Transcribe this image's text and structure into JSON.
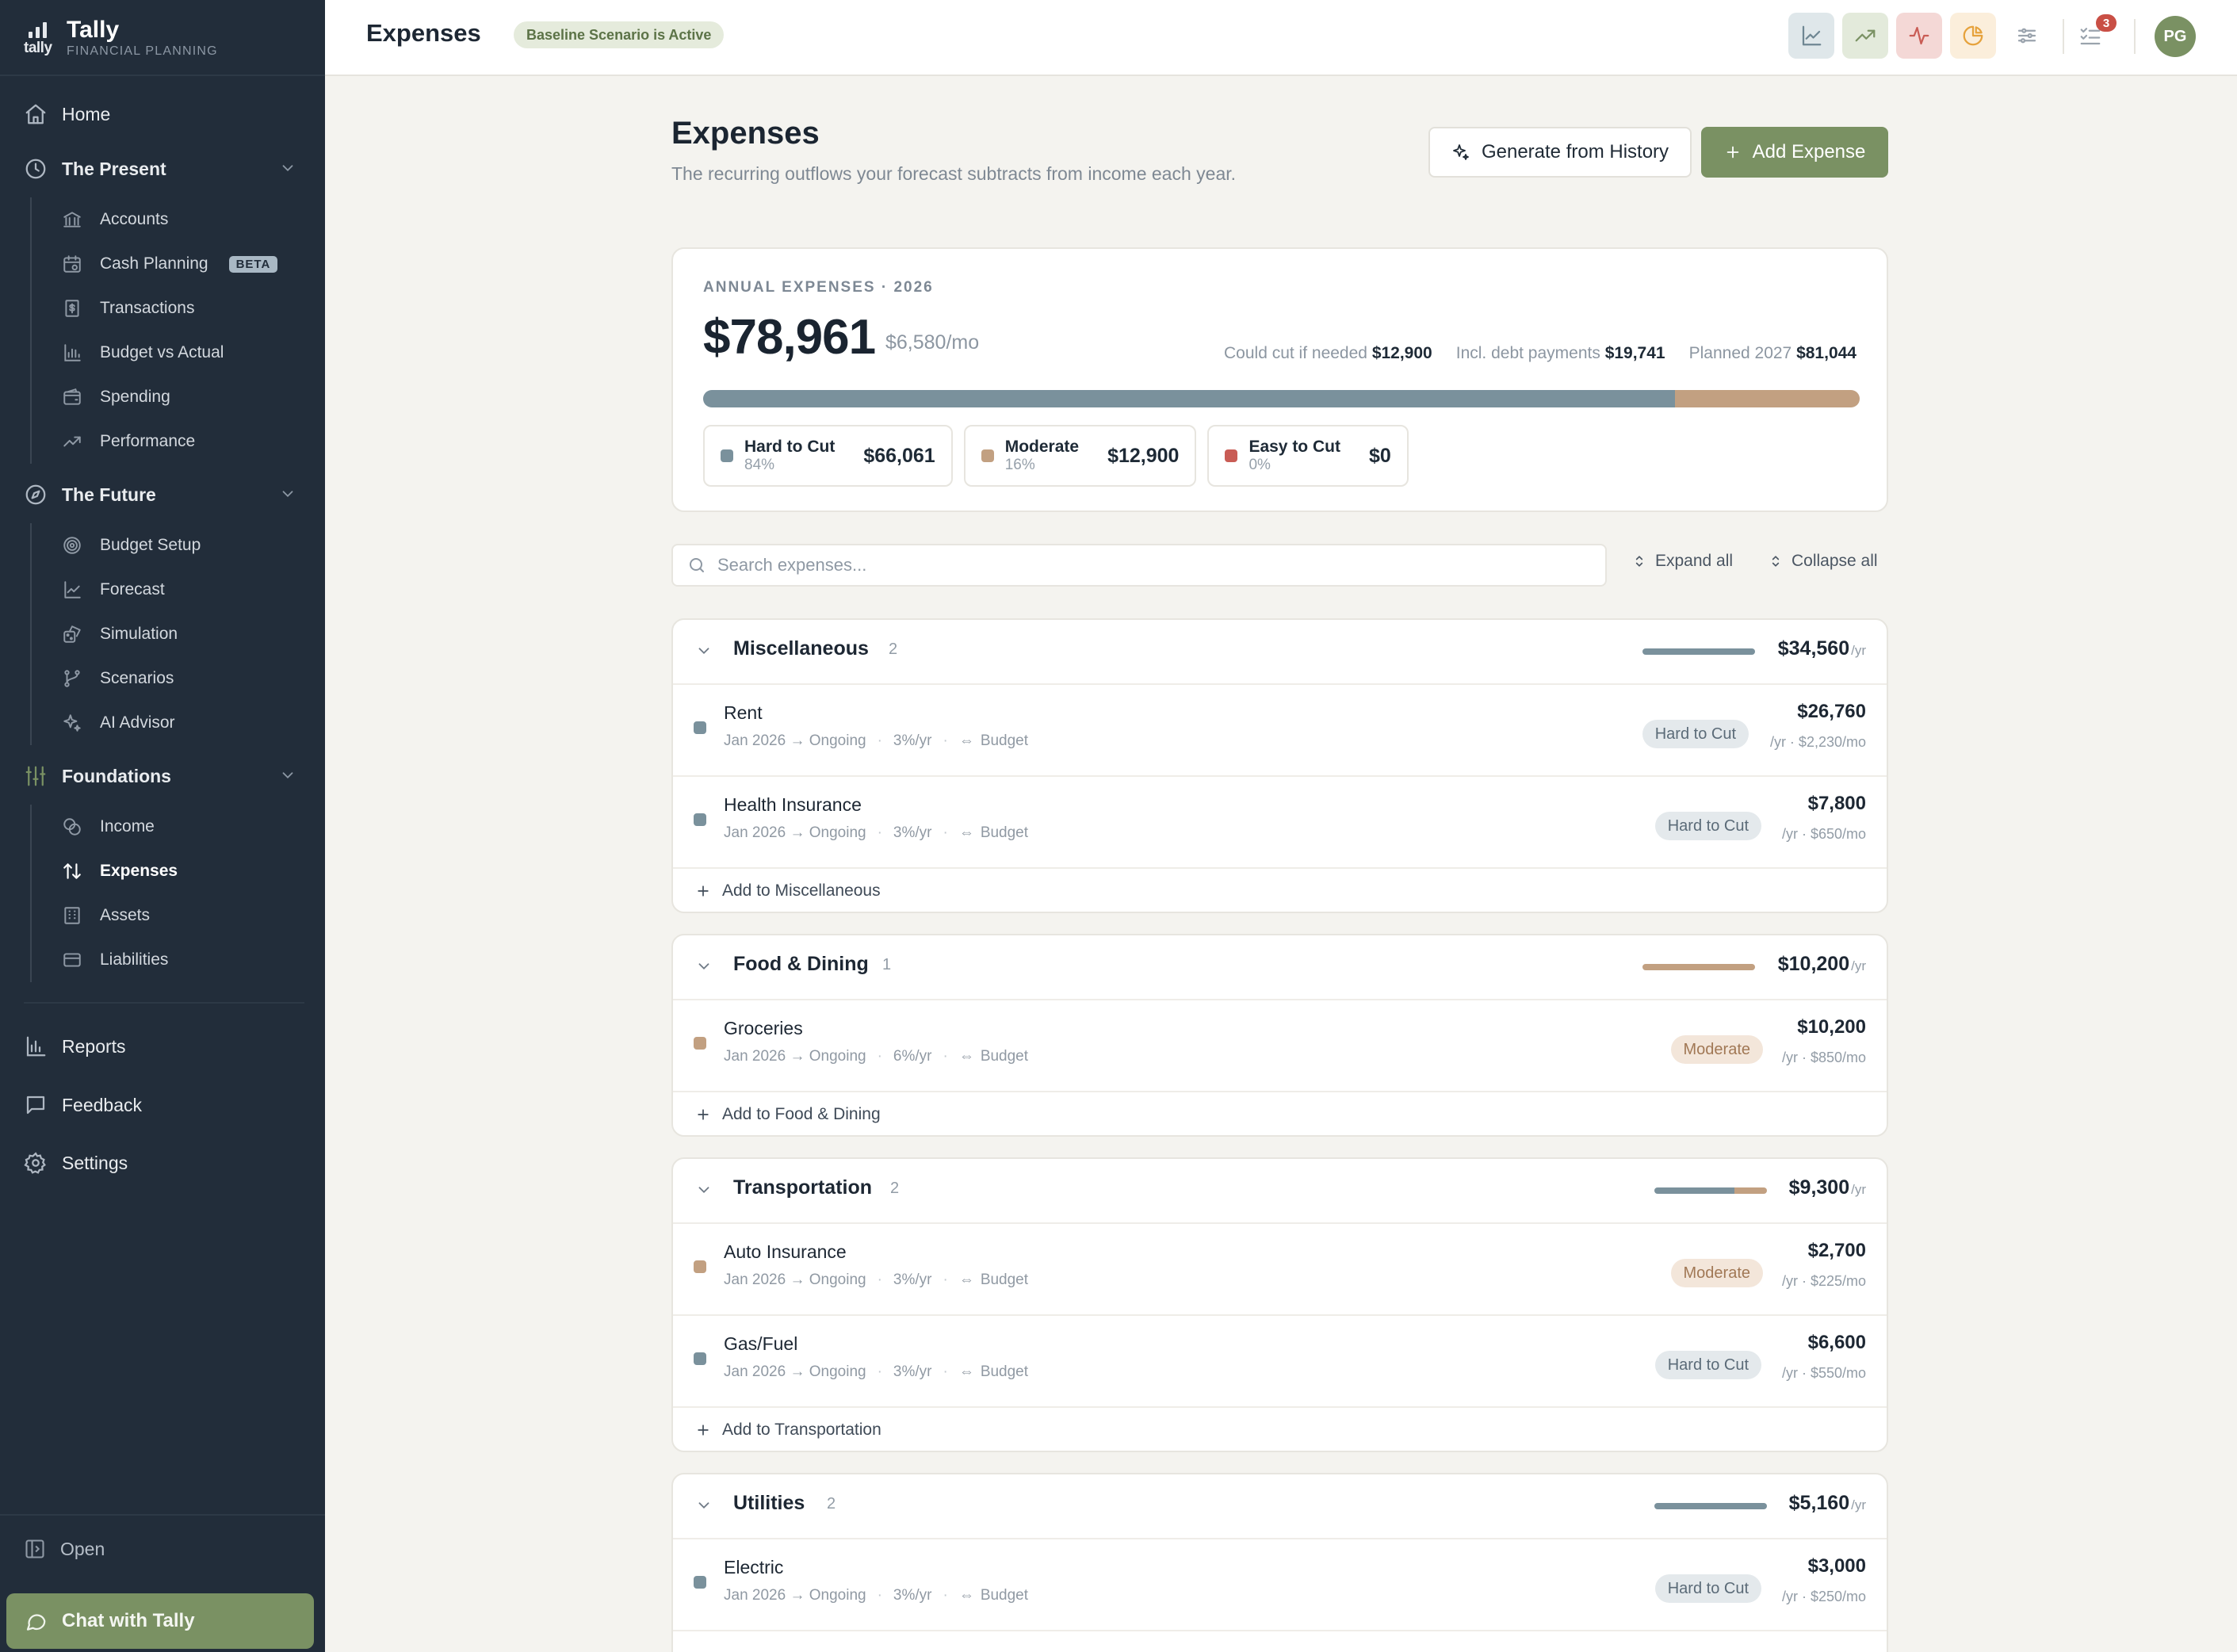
{
  "app": {
    "name": "Tally",
    "subtitle": "FINANCIAL PLANNING",
    "logo_word": "tally"
  },
  "colors": {
    "sidebar_bg": "#222d3a",
    "accent_green": "#7a9163",
    "hard": "#7a919c",
    "moderate": "#c2a081",
    "easy": "#c95c55"
  },
  "sidebar": {
    "home": "Home",
    "present": {
      "label": "The Present",
      "items": [
        {
          "label": "Accounts",
          "icon": "bank-icon"
        },
        {
          "label": "Cash Planning",
          "icon": "calendar-dollar-icon",
          "badge": "BETA"
        },
        {
          "label": "Transactions",
          "icon": "receipt-icon"
        },
        {
          "label": "Budget vs Actual",
          "icon": "bar-chart-icon"
        },
        {
          "label": "Spending",
          "icon": "wallet-icon"
        },
        {
          "label": "Performance",
          "icon": "trend-up-icon"
        }
      ]
    },
    "future": {
      "label": "The Future",
      "items": [
        {
          "label": "Budget Setup",
          "icon": "target-icon"
        },
        {
          "label": "Forecast",
          "icon": "line-chart-icon"
        },
        {
          "label": "Simulation",
          "icon": "dice-icon"
        },
        {
          "label": "Scenarios",
          "icon": "branch-icon"
        },
        {
          "label": "AI Advisor",
          "icon": "sparkles-icon"
        }
      ]
    },
    "foundations": {
      "label": "Foundations",
      "items": [
        {
          "label": "Income",
          "icon": "coins-icon"
        },
        {
          "label": "Expenses",
          "icon": "arrows-updown-icon",
          "active": true
        },
        {
          "label": "Assets",
          "icon": "building-icon"
        },
        {
          "label": "Liabilities",
          "icon": "credit-card-icon"
        }
      ]
    },
    "reports": "Reports",
    "feedback": "Feedback",
    "settings": "Settings",
    "open": "Open",
    "chat": "Chat with Tally"
  },
  "topbar": {
    "title": "Expenses",
    "scenario_badge": "Baseline Scenario is Active",
    "notifications": "3",
    "avatar_initials": "PG"
  },
  "page": {
    "title": "Expenses",
    "description": "The recurring outflows your forecast subtracts from income each year.",
    "generate_label": "Generate from History",
    "add_label": "Add Expense"
  },
  "summary": {
    "label": "ANNUAL EXPENSES · 2026",
    "total": "$78,961",
    "monthly": "$6,580/mo",
    "stats": [
      {
        "label": "Could cut if needed",
        "value": "$12,900"
      },
      {
        "label": "Incl. debt payments",
        "value": "$19,741"
      },
      {
        "label": "Planned 2027",
        "value": "$81,044"
      }
    ],
    "split": {
      "hard": 84,
      "moderate": 16,
      "easy": 0
    },
    "chips": [
      {
        "name": "Hard to Cut",
        "pct": "84%",
        "amount": "$66,061"
      },
      {
        "name": "Moderate",
        "pct": "16%",
        "amount": "$12,900"
      },
      {
        "name": "Easy to Cut",
        "pct": "0%",
        "amount": "$0"
      }
    ]
  },
  "controls": {
    "search_placeholder": "Search expenses...",
    "expand_all": "Expand all",
    "collapse_all": "Collapse all"
  },
  "groups": [
    {
      "name": "Miscellaneous",
      "count": "2",
      "amount": "$34,560",
      "per": "/yr",
      "hard_share": 100,
      "moderate_share": 0,
      "add_label": "Add to Miscellaneous",
      "rows": [
        {
          "name": "Rent",
          "period": "Jan 2026 → Ongoing",
          "growth": "3%/yr",
          "link": "Budget",
          "tag": "Hard to Cut",
          "amount": "$26,760",
          "sub": "/yr · $2,230/mo"
        },
        {
          "name": "Health Insurance",
          "period": "Jan 2026 → Ongoing",
          "growth": "3%/yr",
          "link": "Budget",
          "tag": "Hard to Cut",
          "amount": "$7,800",
          "sub": "/yr · $650/mo"
        }
      ]
    },
    {
      "name": "Food & Dining",
      "count": "1",
      "amount": "$10,200",
      "per": "/yr",
      "hard_share": 0,
      "moderate_share": 100,
      "add_label": "Add to Food & Dining",
      "rows": [
        {
          "name": "Groceries",
          "period": "Jan 2026 → Ongoing",
          "growth": "6%/yr",
          "link": "Budget",
          "tag": "Moderate",
          "amount": "$10,200",
          "sub": "/yr · $850/mo"
        }
      ]
    },
    {
      "name": "Transportation",
      "count": "2",
      "amount": "$9,300",
      "per": "/yr",
      "hard_share": 71,
      "moderate_share": 29,
      "add_label": "Add to Transportation",
      "rows": [
        {
          "name": "Auto Insurance",
          "period": "Jan 2026 → Ongoing",
          "growth": "3%/yr",
          "link": "Budget",
          "tag": "Moderate",
          "amount": "$2,700",
          "sub": "/yr · $225/mo"
        },
        {
          "name": "Gas/Fuel",
          "period": "Jan 2026 → Ongoing",
          "growth": "3%/yr",
          "link": "Budget",
          "tag": "Hard to Cut",
          "amount": "$6,600",
          "sub": "/yr · $550/mo"
        }
      ]
    },
    {
      "name": "Utilities",
      "count": "2",
      "amount": "$5,160",
      "per": "/yr",
      "hard_share": 100,
      "moderate_share": 0,
      "add_label": "",
      "rows": [
        {
          "name": "Electric",
          "period": "Jan 2026 → Ongoing",
          "growth": "3%/yr",
          "link": "Budget",
          "tag": "Hard to Cut",
          "amount": "$3,000",
          "sub": "/yr · $250/mo"
        }
      ]
    }
  ]
}
